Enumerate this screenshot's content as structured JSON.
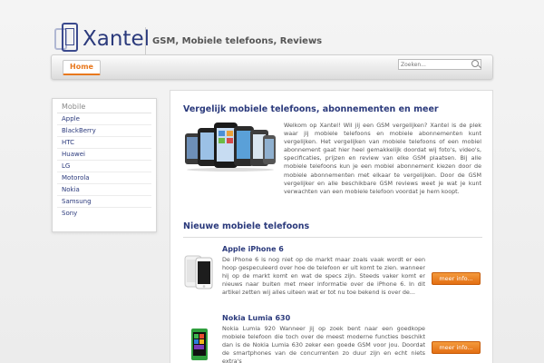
{
  "header": {
    "logo_text": "Xantel",
    "tagline": "GSM, Mobiele telefoons, Reviews"
  },
  "nav": {
    "home_label": "Home",
    "search_placeholder": "Zoeken..."
  },
  "sidebar": {
    "title": "Mobile",
    "items": [
      "Apple",
      "BlackBerry",
      "HTC",
      "Huawei",
      "LG",
      "Motorola",
      "Nokia",
      "Samsung",
      "Sony"
    ]
  },
  "intro": {
    "title": "Vergelijk mobiele telefoons, abonnementen en meer",
    "text": "Welkom op Xantel! Wil jij een GSM vergelijken? Xantel is de plek waar jij mobiele telefoons en mobiele abonnementen kunt vergelijken. Het vergelijken van mobiele telefoons of een mobiel abonnement gaat hier heel gemakkelijk doordat wij foto's, video's, specificaties, prijzen en review van elke GSM plaatsen. Bij alle mobiele telefoons kun je een mobiel abonnement kiezen door de mobiele abonnementen met elkaar te vergelijken. Door de GSM vergelijker en alle beschikbare GSM reviews weet je wat je kunt verwachten van een mobiele telefoon voordat je hem koopt."
  },
  "new_phones": {
    "title": "Nieuwe mobiele telefoons",
    "items": [
      {
        "name": "Apple iPhone 6",
        "description": "De iPhone 6 is nog niet op de markt maar zoals vaak wordt er een hoop gespeculeerd over hoe de telefoon er uit komt te zien. wanneer hij op de markt komt en wat de specs zijn. Steeds vaker komt er nieuws naar buiten met meer informatie over de iPhone 6. In dit artikel zetten wij alles uiteen wat er tot nu toe bekend is over de...",
        "button": "meer info..."
      },
      {
        "name": "Nokia Lumia 630",
        "description": "Nokia Lumia 920 Wanneer jij op zoek bent naar een goedkope mobiele telefoon die toch over de meest moderne functies beschikt dan is de Nokia Lumia 630 zeker een goede GSM voor jou. Doordat de smartphones van de concurrenten zo duur zijn en echt niets extra's",
        "button": "meer info..."
      }
    ]
  },
  "colors": {
    "brand": "#2b3a7c",
    "accent": "#e8781e"
  }
}
